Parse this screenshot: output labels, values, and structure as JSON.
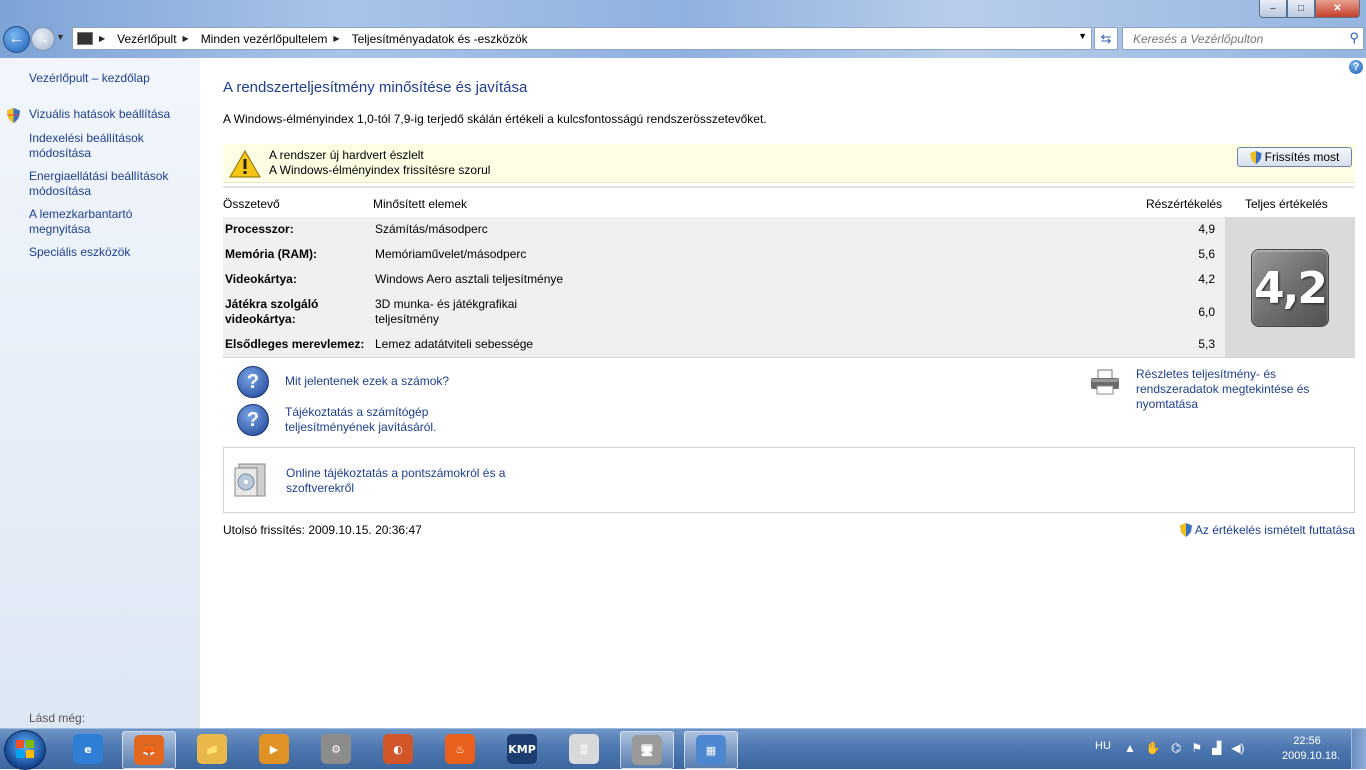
{
  "window": {
    "buttons": {
      "minimize": "–",
      "maximize": "□",
      "close": "✕"
    }
  },
  "address_bar": {
    "segments": [
      "Vezérlőpult",
      "Minden vezérlőpultelem",
      "Teljesítményadatok és -eszközök"
    ],
    "search_placeholder": "Keresés a Vezérlőpulton"
  },
  "sidebar": {
    "items": [
      {
        "label": "Vezérlőpult – kezdőlap"
      },
      {
        "label": "Vizuális hatások beállítása"
      },
      {
        "label": "Indexelési beállítások módosítása"
      },
      {
        "label": "Energiaellátási beállítások módosítása"
      },
      {
        "label": "A lemezkarbantartó megnyitása"
      },
      {
        "label": "Speciális eszközök"
      }
    ],
    "see_also": "Lásd még:"
  },
  "main": {
    "help": "?",
    "title": "A rendszerteljesítmény minősítése és javítása",
    "description": "A Windows-élményindex 1,0-tól 7,9-ig terjedő skálán értékeli a kulcsfontosságú rendszerösszetevőket.",
    "notice": {
      "line1": "A rendszer új hardvert észlelt",
      "line2": "A Windows-élményindex frissítésre szorul",
      "button": "Frissítés most"
    },
    "table": {
      "headers": [
        "Összetevő",
        "Minősített elemek",
        "Részértékelés",
        "Teljes értékelés"
      ],
      "rows": [
        {
          "component": "Processzor:",
          "item": "Számítás/másodperc",
          "score": "4,9"
        },
        {
          "component": "Memória (RAM):",
          "item": "Memóriaművelet/másodperc",
          "score": "5,6"
        },
        {
          "component": "Videokártya:",
          "item": "Windows Aero asztali teljesítménye",
          "score": "4,2"
        },
        {
          "component": "Játékra szolgáló videokártya:",
          "item": "3D munka- és játékgrafikai teljesítmény",
          "score": "6,0"
        },
        {
          "component": "Elsődleges merevlemez:",
          "item": "Lemez adatátviteli sebessége",
          "score": "5,3"
        }
      ],
      "base_score": "4,2"
    },
    "links": {
      "what_numbers_mean": "Mit jelentenek ezek a számok?",
      "improve_tips": "Tájékoztatás a számítógép teljesítményének javításáról.",
      "detailed_info": "Részletes teljesítmény- és rendszeradatok megtekintése és nyomtatása",
      "online_info": "Online tájékoztatás a pontszámokról és a szoftverekről"
    },
    "last_refresh": "Utolsó frissítés: 2009.10.15. 20:36:47",
    "rerun": "Az értékelés ismételt futtatása"
  },
  "taskbar": {
    "apps": [
      {
        "name": "Internet Explorer",
        "icon": "ie-icon",
        "color": "#2f7fd6",
        "glyph": "e"
      },
      {
        "name": "Firefox",
        "icon": "firefox-icon",
        "color": "#e1681e",
        "glyph": "🦊"
      },
      {
        "name": "Explorer",
        "icon": "folder-icon",
        "color": "#e8b94a",
        "glyph": "📁"
      },
      {
        "name": "Media Player",
        "icon": "media-player-icon",
        "color": "#e09225",
        "glyph": "▶"
      },
      {
        "name": "Device Manager",
        "icon": "device-icon",
        "color": "#8c8c8c",
        "glyph": "⚙"
      },
      {
        "name": "Burner",
        "icon": "burner-icon",
        "color": "#d1562a",
        "glyph": "◐"
      },
      {
        "name": "Nero",
        "icon": "nero-icon",
        "color": "#e8601c",
        "glyph": "♨"
      },
      {
        "name": "KMPlayer",
        "icon": "kmp-icon",
        "color": "#1d3d70",
        "glyph": "KMP"
      },
      {
        "name": "Document",
        "icon": "document-icon",
        "color": "#d9d9d9",
        "glyph": "≣"
      },
      {
        "name": "System",
        "icon": "computer-icon",
        "color": "#9a9a9a",
        "glyph": "🖥"
      },
      {
        "name": "Control Panel",
        "icon": "control-panel-icon",
        "color": "#4d87cf",
        "glyph": "▦"
      }
    ],
    "language": "HU",
    "clock": {
      "time": "22:56",
      "date": "2009.10.18."
    }
  }
}
